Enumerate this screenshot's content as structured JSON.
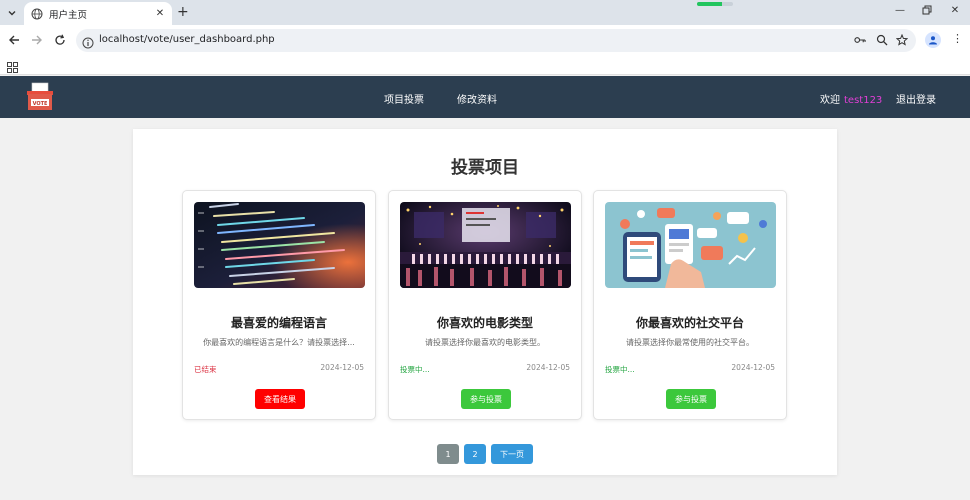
{
  "browser": {
    "tab_title": "用户主页",
    "url": "localhost/vote/user_dashboard.php",
    "loading_progress": 0.7
  },
  "header": {
    "menu": [
      {
        "label": "项目投票"
      },
      {
        "label": "修改资料"
      }
    ],
    "welcome_label": "欢迎",
    "username": "test123",
    "logout_label": "退出登录",
    "logo_text": "VOTE"
  },
  "main": {
    "title": "投票项目",
    "cards": [
      {
        "title": "最喜爱的编程语言",
        "description": "你最喜欢的编程语言是什么？请投票选择...",
        "status": "已结束",
        "status_color": "#dc3545",
        "date": "2024-12-05",
        "button": "查看结果",
        "button_color": "#ff0000",
        "image": "code-screen-image"
      },
      {
        "title": "你喜欢的电影类型",
        "description": "请投票选择你最喜欢的电影类型。",
        "status": "投票中...",
        "status_color": "#28a745",
        "date": "2024-12-05",
        "button": "参与投票",
        "button_color": "#3cc83c",
        "image": "film-festival-stage-image"
      },
      {
        "title": "你最喜欢的社交平台",
        "description": "请投票选择你最常使用的社交平台。",
        "status": "投票中...",
        "status_color": "#28a745",
        "date": "2024-12-05",
        "button": "参与投票",
        "button_color": "#3cc83c",
        "image": "social-media-illustration-image"
      }
    ],
    "pagination": {
      "pages": [
        "1",
        "2"
      ],
      "next_label": "下一页",
      "current_color": "#7f8c8d",
      "link_color": "#3498db"
    }
  }
}
